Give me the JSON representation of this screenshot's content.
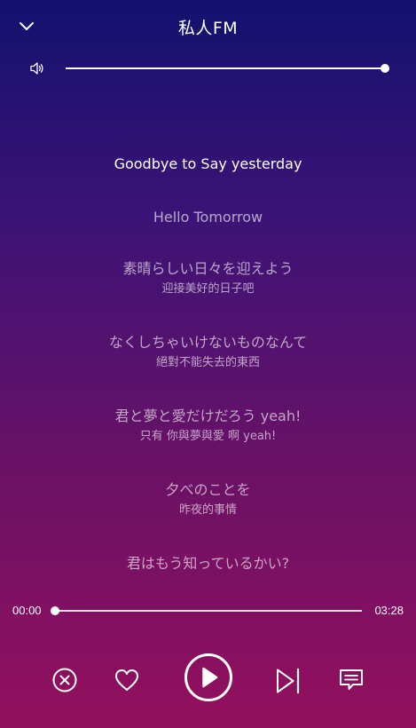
{
  "header": {
    "title": "私人FM"
  },
  "volume": {
    "level": 1.0
  },
  "lyrics": [
    {
      "original": "Goodbye to Say yesterday",
      "translation": "",
      "current": true
    },
    {
      "original": "Hello Tomorrow",
      "translation": "",
      "current": false
    },
    {
      "original": "素晴らしい日々を迎えよう",
      "translation": "迎接美好的日子吧",
      "current": false
    },
    {
      "original": "なくしちゃいけないものなんて",
      "translation": "絕對不能失去的東西",
      "current": false
    },
    {
      "original": "君と夢と愛だけだろう yeah!",
      "translation": "只有 你與夢與愛 啊 yeah!",
      "current": false
    },
    {
      "original": "夕べのことを",
      "translation": "昨夜的事情",
      "current": false
    },
    {
      "original": "君はもう知っているかい?",
      "translation": "",
      "current": false
    }
  ],
  "progress": {
    "current_time": "00:00",
    "total_time": "03:28",
    "fraction": 0.0
  },
  "controls": {
    "icons": [
      "close-circle-icon",
      "heart-icon",
      "play-icon",
      "skip-next-icon",
      "comment-icon"
    ]
  }
}
